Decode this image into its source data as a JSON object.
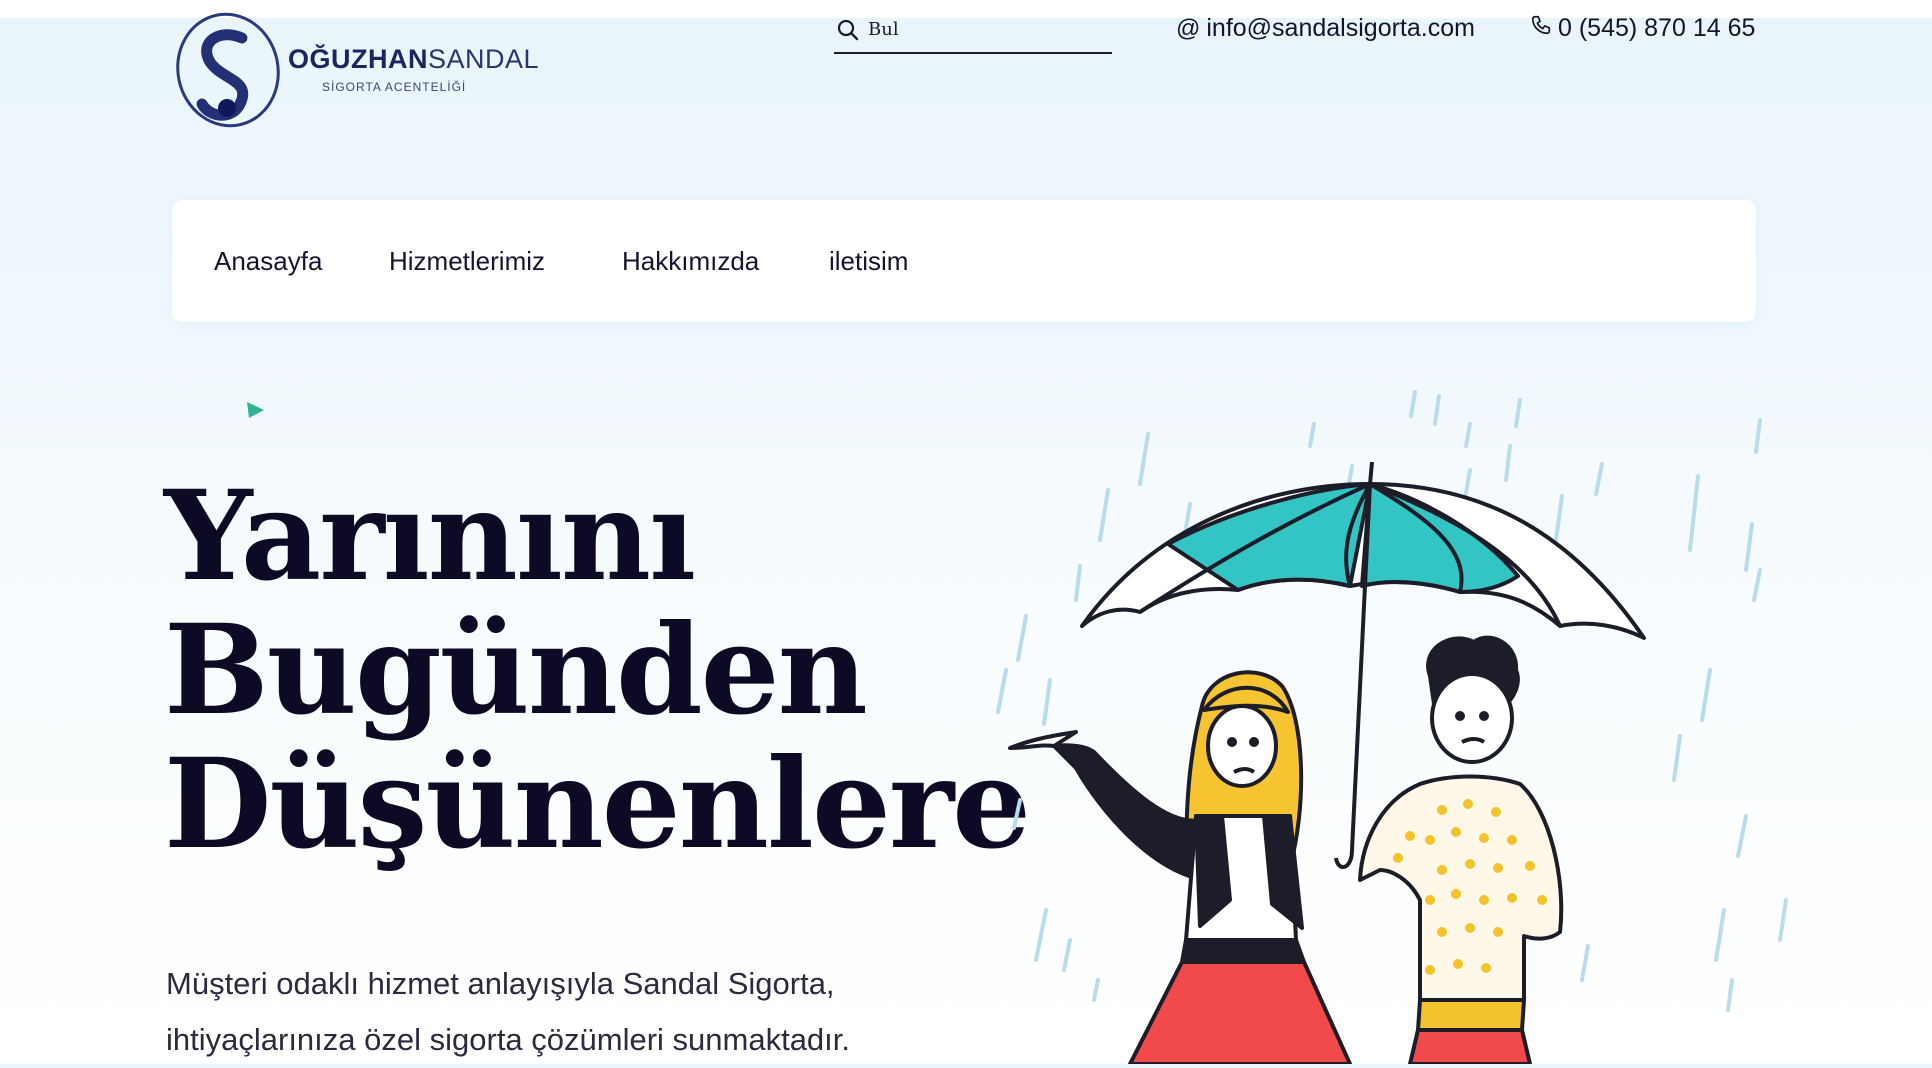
{
  "brand": {
    "name_bold": "OĞUZHAN",
    "name_light": "SANDAL",
    "tagline": "SİGORTA ACENTELİĞİ",
    "logo_letter": "S"
  },
  "search": {
    "placeholder": "Bul"
  },
  "contact": {
    "email": "info@sandalsigorta.com",
    "phone": "0 (545) 870 14 65"
  },
  "nav": {
    "items": [
      {
        "label": "Anasayfa"
      },
      {
        "label": "Hizmetlerimiz"
      },
      {
        "label": "Hakkımızda"
      },
      {
        "label": "iletisim"
      }
    ]
  },
  "hero": {
    "title_lines": [
      "Yarınını",
      "Bugünden",
      "Düşünenlere"
    ],
    "text_lines": [
      "Müşteri odaklı hizmet anlayışıyla Sandal Sigorta,",
      "ihtiyaçlarınıza özel sigorta çözümleri sunmaktadır."
    ]
  },
  "icons": {
    "search": "search-icon",
    "email": "at-sign-icon",
    "phone": "phone-icon",
    "illustration": "umbrella-couple-illustration"
  },
  "colors": {
    "accent_teal": "#2ec4c6",
    "brand_navy": "#1c2560",
    "dress_red": "#f24a4a",
    "hair_yellow": "#f7c431"
  }
}
